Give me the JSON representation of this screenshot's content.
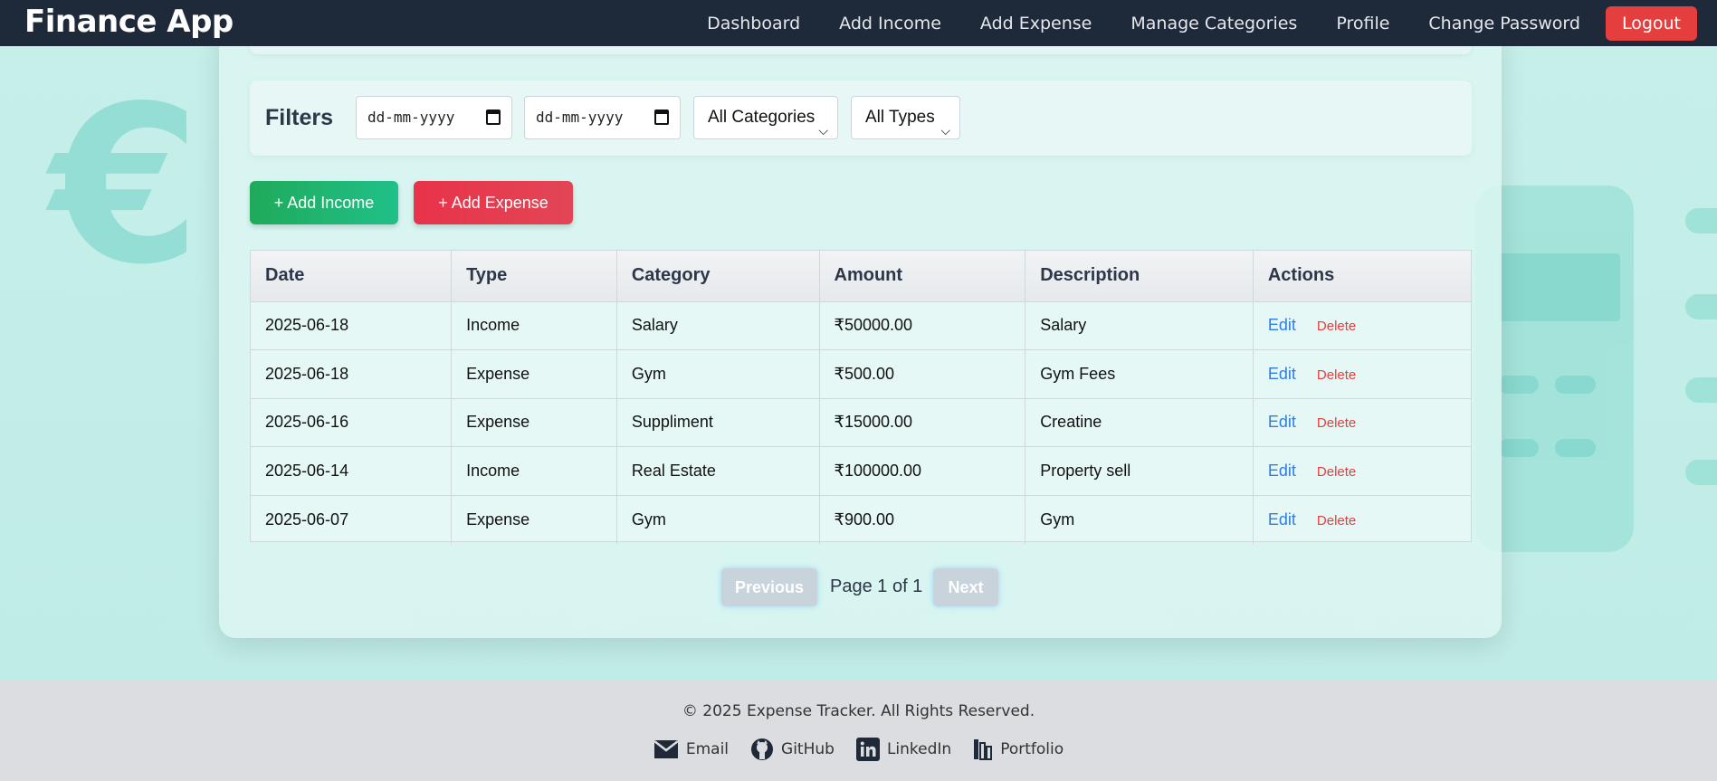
{
  "navbar": {
    "brand": "Finance App",
    "links": [
      "Dashboard",
      "Add Income",
      "Add Expense",
      "Manage Categories",
      "Profile",
      "Change Password"
    ],
    "logout_label": "Logout"
  },
  "filters": {
    "title": "Filters",
    "start_date_placeholder": "dd-mm-yyyy",
    "end_date_placeholder": "dd-mm-yyyy",
    "category_selected": "All Categories",
    "type_selected": "All Types"
  },
  "actions": {
    "add_income_label": "+ Add Income",
    "add_expense_label": "+ Add Expense"
  },
  "table": {
    "columns": [
      "Date",
      "Type",
      "Category",
      "Amount",
      "Description",
      "Actions"
    ],
    "rows": [
      {
        "date": "2025-06-18",
        "type": "Income",
        "category": "Salary",
        "amount": "₹50000.00",
        "description": "Salary"
      },
      {
        "date": "2025-06-18",
        "type": "Expense",
        "category": "Gym",
        "amount": "₹500.00",
        "description": "Gym Fees"
      },
      {
        "date": "2025-06-16",
        "type": "Expense",
        "category": "Suppliment",
        "amount": "₹15000.00",
        "description": "Creatine"
      },
      {
        "date": "2025-06-14",
        "type": "Income",
        "category": "Real Estate",
        "amount": "₹100000.00",
        "description": "Property sell"
      },
      {
        "date": "2025-06-07",
        "type": "Expense",
        "category": "Gym",
        "amount": "₹900.00",
        "description": "Gym"
      }
    ],
    "edit_label": "Edit",
    "delete_label": "Delete"
  },
  "pagination": {
    "previous_label": "Previous",
    "page_info": "Page 1 of 1",
    "next_label": "Next"
  },
  "footer": {
    "copyright": "© 2025 Expense Tracker. All Rights Reserved.",
    "links": [
      {
        "label": "Email",
        "icon": "mail-icon"
      },
      {
        "label": "GitHub",
        "icon": "github-icon"
      },
      {
        "label": "LinkedIn",
        "icon": "linkedin-icon"
      },
      {
        "label": "Portfolio",
        "icon": "portfolio-icon"
      }
    ]
  },
  "colors": {
    "navbar": "#1e2a3a",
    "logout": "#e53e3e",
    "income_button": "#1faa5a",
    "expense_button": "#e8334a",
    "edit_link": "#2b7de9",
    "delete_link": "#e53e3e"
  }
}
